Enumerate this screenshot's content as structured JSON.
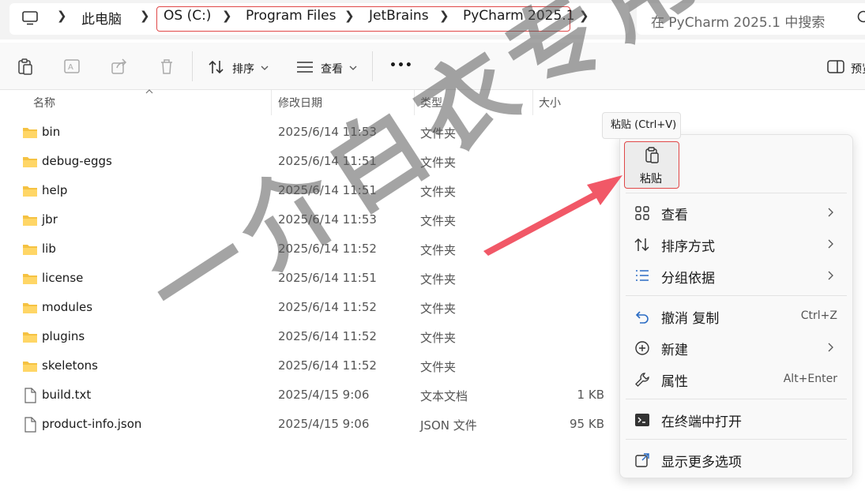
{
  "address_bar": {
    "breadcrumbs": [
      "此电脑",
      "OS (C:)",
      "Program Files",
      "JetBrains",
      "PyCharm 2025.1"
    ],
    "search_placeholder": "在 PyCharm 2025.1 中搜索"
  },
  "toolbar": {
    "sort_label": "排序",
    "view_label": "查看",
    "more_label": "•••",
    "preview_label": "预览"
  },
  "columns": {
    "name": "名称",
    "date": "修改日期",
    "type": "类型",
    "size": "大小"
  },
  "files": [
    {
      "name": "bin",
      "date": "2025/6/14 11:53",
      "type": "文件夹",
      "size": "",
      "kind": "folder"
    },
    {
      "name": "debug-eggs",
      "date": "2025/6/14 11:51",
      "type": "文件夹",
      "size": "",
      "kind": "folder"
    },
    {
      "name": "help",
      "date": "2025/6/14 11:51",
      "type": "文件夹",
      "size": "",
      "kind": "folder"
    },
    {
      "name": "jbr",
      "date": "2025/6/14 11:53",
      "type": "文件夹",
      "size": "",
      "kind": "folder"
    },
    {
      "name": "lib",
      "date": "2025/6/14 11:52",
      "type": "文件夹",
      "size": "",
      "kind": "folder"
    },
    {
      "name": "license",
      "date": "2025/6/14 11:51",
      "type": "文件夹",
      "size": "",
      "kind": "folder"
    },
    {
      "name": "modules",
      "date": "2025/6/14 11:52",
      "type": "文件夹",
      "size": "",
      "kind": "folder"
    },
    {
      "name": "plugins",
      "date": "2025/6/14 11:52",
      "type": "文件夹",
      "size": "",
      "kind": "folder"
    },
    {
      "name": "skeletons",
      "date": "2025/6/14 11:52",
      "type": "文件夹",
      "size": "",
      "kind": "folder"
    },
    {
      "name": "build.txt",
      "date": "2025/4/15 9:06",
      "type": "文本文档",
      "size": "1 KB",
      "kind": "file"
    },
    {
      "name": "product-info.json",
      "date": "2025/4/15 9:06",
      "type": "JSON 文件",
      "size": "95 KB",
      "kind": "file"
    }
  ],
  "context_menu": {
    "tooltip": "粘贴 (Ctrl+V)",
    "paste_label": "粘贴",
    "items": [
      {
        "label": "查看",
        "shortcut": "",
        "submenu": true,
        "icon": "grid-icon"
      },
      {
        "label": "排序方式",
        "shortcut": "",
        "submenu": true,
        "icon": "sort-icon"
      },
      {
        "label": "分组依据",
        "shortcut": "",
        "submenu": true,
        "icon": "group-list-icon"
      },
      {
        "label": "撤消 复制",
        "shortcut": "Ctrl+Z",
        "submenu": false,
        "icon": "undo-icon"
      },
      {
        "label": "新建",
        "shortcut": "",
        "submenu": true,
        "icon": "new-plus-icon"
      },
      {
        "label": "属性",
        "shortcut": "Alt+Enter",
        "submenu": false,
        "icon": "wrench-icon"
      },
      {
        "label": "在终端中打开",
        "shortcut": "",
        "submenu": false,
        "icon": "terminal-icon"
      },
      {
        "label": "显示更多选项",
        "shortcut": "",
        "submenu": false,
        "icon": "open-external-icon"
      }
    ]
  },
  "watermark": "一介白衣专用",
  "colors": {
    "highlight_border": "#e04848",
    "folder": "#f5c242",
    "arrow": "#f04a5a"
  }
}
